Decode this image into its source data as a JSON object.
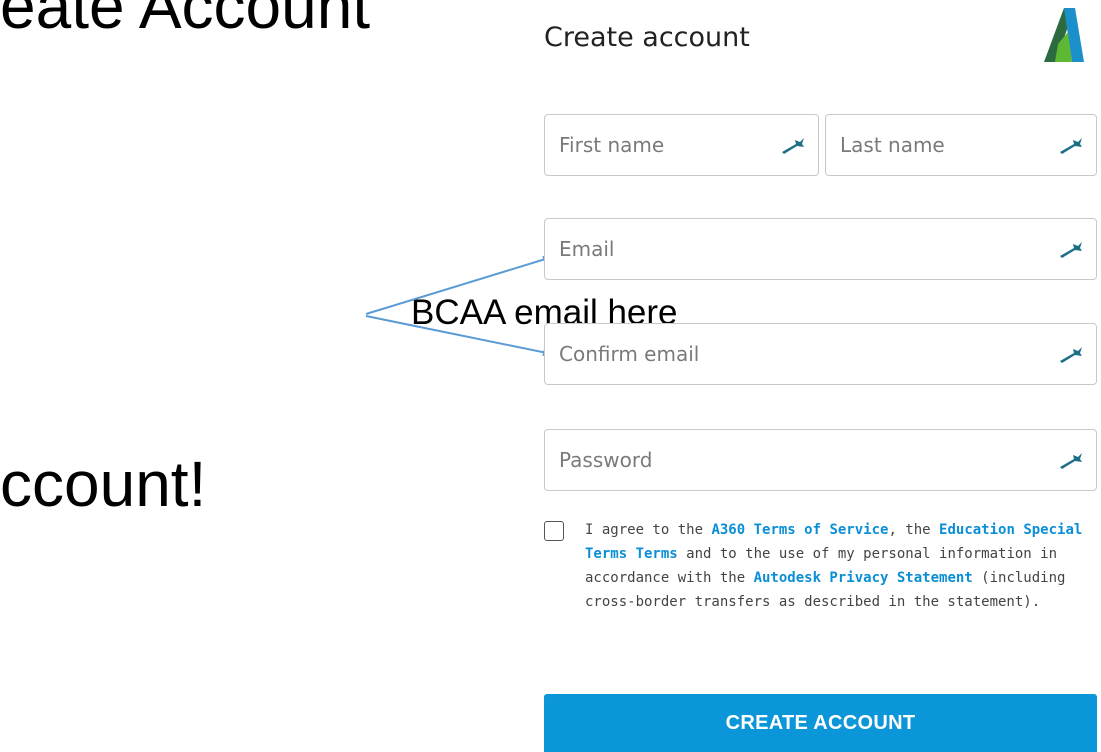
{
  "slide": {
    "title_fragment": "eate Account",
    "body_fragment": "ccount!",
    "callout": "BCAA email here"
  },
  "form": {
    "title": "Create account",
    "logo_icon": "autodesk-logo-icon",
    "fields": {
      "first_name": {
        "placeholder": "First name",
        "value": ""
      },
      "last_name": {
        "placeholder": "Last name",
        "value": ""
      },
      "email": {
        "placeholder": "Email",
        "value": ""
      },
      "confirm_email": {
        "placeholder": "Confirm email",
        "value": ""
      },
      "password": {
        "placeholder": "Password",
        "value": ""
      }
    },
    "field_icon": "password-manager-key-icon",
    "agreement": {
      "checked": false,
      "t1": "I agree to the ",
      "link1": "A360 Terms of Service",
      "t2": ", the ",
      "link2": "Education Special Terms Terms",
      "t3": " and to the use of my personal information in accordance with the ",
      "link3": "Autodesk Privacy Statement",
      "t4": " (including cross-border transfers as described in the statement)."
    },
    "submit_label": "CREATE ACCOUNT"
  },
  "colors": {
    "button_blue": "#0a96d8",
    "link_blue": "#0a8fd6",
    "field_border": "#c8c8c8",
    "key_icon_teal": "#1c6f86",
    "callout_arrow": "#5b9bd5"
  }
}
